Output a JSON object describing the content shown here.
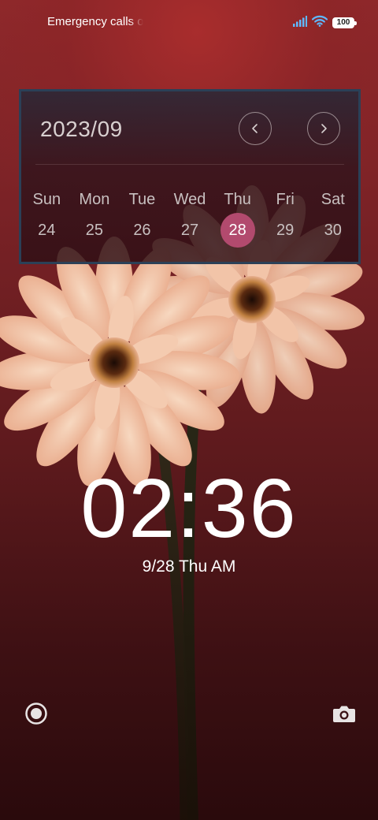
{
  "status_bar": {
    "carrier_text": "Emergency calls o",
    "battery_level": "100",
    "icons": [
      "signal-icon",
      "wifi-icon",
      "battery-icon"
    ]
  },
  "calendar": {
    "month_title": "2023/09",
    "prev_icon": "chevron-left-icon",
    "next_icon": "chevron-right-icon",
    "weekdays": [
      "Sun",
      "Mon",
      "Tue",
      "Wed",
      "Thu",
      "Fri",
      "Sat"
    ],
    "dates": [
      "24",
      "25",
      "26",
      "27",
      "28",
      "29",
      "30"
    ],
    "selected_date": "28",
    "selected_color": "#b24a6e"
  },
  "clock": {
    "time": "02:36",
    "date_line": "9/28 Thu AM"
  },
  "shortcuts": {
    "left_icon": "record-icon",
    "right_icon": "camera-icon"
  }
}
